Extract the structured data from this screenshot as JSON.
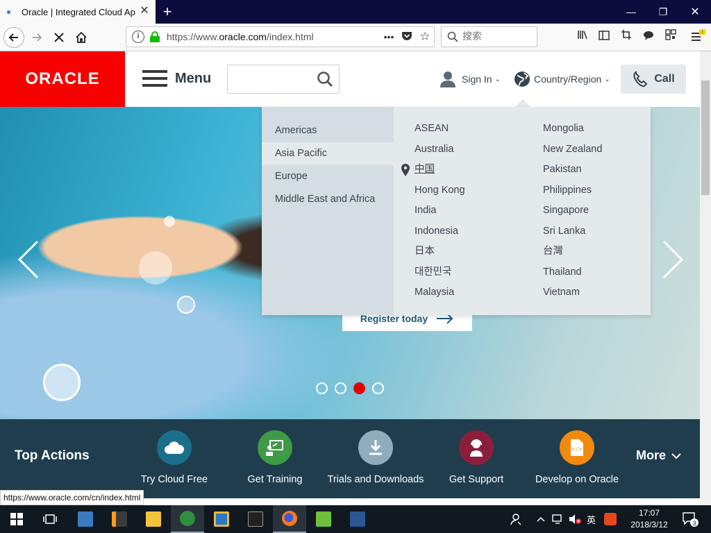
{
  "browser": {
    "tab_title": "Oracle | Integrated Cloud Ap",
    "url_prefix": "https://www.",
    "url_domain": "oracle.com",
    "url_path": "/index.html",
    "search_placeholder": "搜索",
    "status_url": "https://www.oracle.com/cn/index.html"
  },
  "header": {
    "logo": "ORACLE",
    "menu_label": "Menu",
    "signin_label": "Sign In",
    "country_label": "Country/Region",
    "call_label": "Call"
  },
  "dropdown": {
    "regions": [
      "Americas",
      "Asia Pacific",
      "Europe",
      "Middle East and Africa"
    ],
    "selected_region": "Asia Pacific",
    "countries_col1": [
      "ASEAN",
      "Australia",
      "中国",
      "Hong Kong",
      "India",
      "Indonesia",
      "日本",
      "대한민국",
      "Malaysia"
    ],
    "countries_col2": [
      "Mongolia",
      "New Zealand",
      "Pakistan",
      "Philippines",
      "Singapore",
      "Sri Lanka",
      "台灣",
      "Thailand",
      "Vietnam"
    ],
    "current_country": "中国"
  },
  "hero": {
    "cta_label": "Register today",
    "slide_count": 4,
    "active_slide": 3
  },
  "actions": {
    "title": "Top Actions",
    "items": [
      {
        "label": "Try Cloud Free",
        "color": "#1b6f8a",
        "icon": "cloud-icon"
      },
      {
        "label": "Get Training",
        "color": "#3d9a45",
        "icon": "training-icon"
      },
      {
        "label": "Trials and Downloads",
        "color": "#8eacbb",
        "icon": "download-icon"
      },
      {
        "label": "Get Support",
        "color": "#8b1f3b",
        "icon": "support-icon"
      },
      {
        "label": "Develop on Oracle",
        "color": "#f28a10",
        "icon": "code-icon"
      }
    ],
    "more_label": "More"
  },
  "taskbar": {
    "time": "17:07",
    "date": "2018/3/12",
    "ime": "英",
    "notification_count": "3"
  },
  "colors": {
    "brand_red": "#f80000",
    "actions_bg": "#1f3d4d",
    "dropdown_bg": "#e4e9ec"
  }
}
